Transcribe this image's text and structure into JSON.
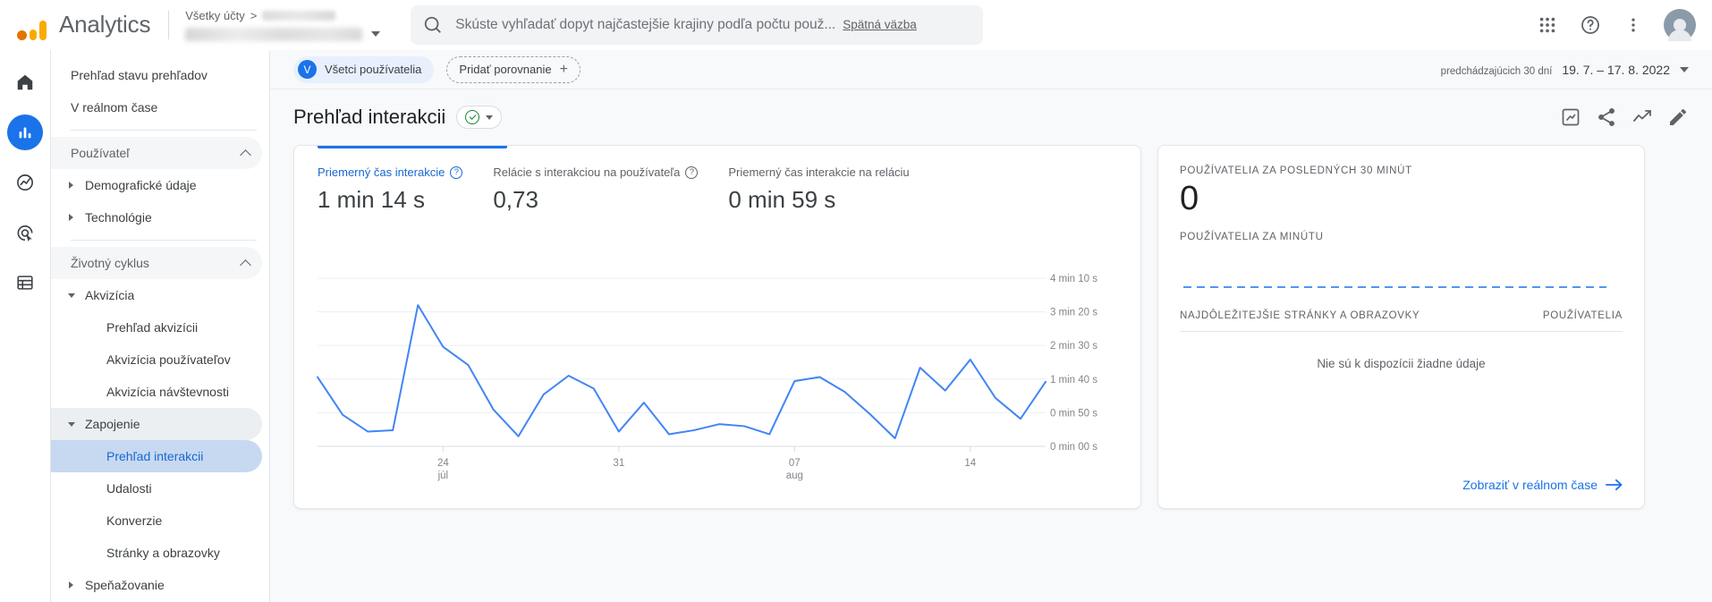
{
  "header": {
    "brand": "Analytics",
    "breadcrumb_all_accounts": "Všetky účty",
    "breadcrumb_sep": ">",
    "search_placeholder": "Skúste vyhľadať dopyt najčastejšie krajiny podľa počtu použ...",
    "feedback_label": "Spätná väzba",
    "icons": {
      "search": "search-icon",
      "apps": "apps-grid-icon",
      "help": "help-circle-icon",
      "more": "more-vertical-icon",
      "avatar": "user-avatar"
    }
  },
  "rail": {
    "items": [
      {
        "name": "home",
        "label": "Domov",
        "active": false
      },
      {
        "name": "reports",
        "label": "Prehľady",
        "active": true
      },
      {
        "name": "explore",
        "label": "Preskúmať",
        "active": false
      },
      {
        "name": "advertising",
        "label": "Reklama",
        "active": false
      },
      {
        "name": "configure",
        "label": "Konfigurovať",
        "active": false
      }
    ]
  },
  "sidebar": {
    "items": [
      {
        "label": "Prehľad stavu prehľadov",
        "level": 0,
        "marker": "none",
        "state": "normal"
      },
      {
        "label": "V reálnom čase",
        "level": 0,
        "marker": "none",
        "state": "normal"
      },
      {
        "label": "SEPARATOR",
        "level": 0,
        "marker": "none",
        "state": "separator"
      },
      {
        "label": "Používateľ",
        "level": 0,
        "marker": "chevron-up",
        "state": "section"
      },
      {
        "label": "Demografické údaje",
        "level": 1,
        "marker": "triangle-right",
        "state": "normal"
      },
      {
        "label": "Technológie",
        "level": 1,
        "marker": "triangle-right",
        "state": "normal"
      },
      {
        "label": "SEPARATOR",
        "level": 0,
        "marker": "none",
        "state": "separator"
      },
      {
        "label": "Životný cyklus",
        "level": 0,
        "marker": "chevron-up",
        "state": "section"
      },
      {
        "label": "Akvizícia",
        "level": 1,
        "marker": "triangle-down",
        "state": "normal"
      },
      {
        "label": "Prehľad akvizícii",
        "level": 2,
        "marker": "none",
        "state": "normal"
      },
      {
        "label": "Akvizícia používateľov",
        "level": 2,
        "marker": "none",
        "state": "normal"
      },
      {
        "label": "Akvizícia návštevnosti",
        "level": 2,
        "marker": "none",
        "state": "normal"
      },
      {
        "label": "Zapojenie",
        "level": 1,
        "marker": "triangle-down",
        "state": "group-highlight"
      },
      {
        "label": "Prehľad interakcii",
        "level": 2,
        "marker": "none",
        "state": "selected"
      },
      {
        "label": "Udalosti",
        "level": 2,
        "marker": "none",
        "state": "normal"
      },
      {
        "label": "Konverzie",
        "level": 2,
        "marker": "none",
        "state": "normal"
      },
      {
        "label": "Stránky a obrazovky",
        "level": 2,
        "marker": "none",
        "state": "normal"
      },
      {
        "label": "Speňažovanie",
        "level": 1,
        "marker": "triangle-right",
        "state": "normal"
      }
    ]
  },
  "controls": {
    "segment_chip": {
      "avatar_letter": "V",
      "label": "Všetci používatelia"
    },
    "add_comparison": {
      "label": "Pridať porovnanie",
      "plus": "+"
    },
    "date_range": {
      "prefix": "predchádzajúcich 30 dní",
      "value": "19. 7. – 17. 8. 2022"
    }
  },
  "page": {
    "title": "Prehľad interakcii",
    "actions": [
      {
        "name": "insights-icon"
      },
      {
        "name": "share-icon"
      },
      {
        "name": "trend-icon"
      },
      {
        "name": "edit-pencil-icon"
      }
    ]
  },
  "chart_card": {
    "metrics": [
      {
        "label": "Priemerný čas interakcie",
        "value": "1 min 14 s",
        "has_help": true,
        "active": true
      },
      {
        "label": "Relácie s interakciou na používateľa",
        "value": "0,73",
        "has_help": true,
        "active": false
      },
      {
        "label": "Priemerný čas interakcie na reláciu",
        "value": "0 min 59 s",
        "has_help": false,
        "active": false
      }
    ]
  },
  "chart_data": {
    "type": "line",
    "title": "Priemerný čas interakcie",
    "xlabel": "",
    "ylabel": "",
    "grid": true,
    "legend": "none",
    "line_color": "#4285f4",
    "ylim": [
      0,
      250
    ],
    "ytick_values": [
      0,
      50,
      100,
      150,
      200,
      250
    ],
    "ytick_labels": [
      "0 min 00 s",
      "0 min 50 s",
      "1 min 40 s",
      "2 min 30 s",
      "3 min 20 s",
      "4 min 10 s"
    ],
    "xtick_positions": [
      5,
      12,
      19,
      26
    ],
    "xtick_labels": [
      {
        "top": "24",
        "bottom": "júl"
      },
      {
        "top": "31",
        "bottom": ""
      },
      {
        "top": "07",
        "bottom": "aug"
      },
      {
        "top": "14",
        "bottom": ""
      }
    ],
    "x": [
      0,
      1,
      2,
      3,
      4,
      5,
      6,
      7,
      8,
      9,
      10,
      11,
      12,
      13,
      14,
      15,
      16,
      17,
      18,
      19,
      20,
      21,
      22,
      23,
      24,
      25,
      26,
      27,
      28,
      29
    ],
    "values": [
      103,
      47,
      22,
      24,
      210,
      148,
      121,
      55,
      15,
      77,
      105,
      86,
      22,
      65,
      18,
      24,
      33,
      30,
      18,
      97,
      103,
      81,
      48,
      12,
      117,
      83,
      129,
      72,
      41,
      96
    ]
  },
  "realtime_card": {
    "users_30min_label": "POUŽÍVATELIA ZA POSLEDNÝCH 30 MINÚT",
    "users_30min_value": "0",
    "users_per_minute_label": "POUŽÍVATELIA ZA MINÚTU",
    "table_col_pages": "NAJDÔLEŽITEJŠIE STRÁNKY A OBRAZOVKY",
    "table_col_users": "POUŽÍVATELIA",
    "empty_message": "Nie sú k dispozícii žiadne údaje",
    "link_label": "Zobraziť v reálnom čase",
    "spark_color": "#1a73e8"
  },
  "colors": {
    "accent": "#1a73e8",
    "line": "#4285f4",
    "selected_bg": "#c7d9f1",
    "chip_bg": "#e8f0fe",
    "green": "#188038"
  }
}
